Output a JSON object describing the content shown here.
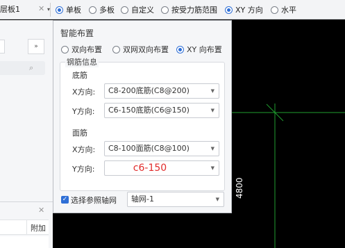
{
  "toolbar": {
    "layer_select": "层板1",
    "options": [
      {
        "label": "单板",
        "selected": true
      },
      {
        "label": "多板",
        "selected": false
      },
      {
        "label": "自定义",
        "selected": false
      },
      {
        "label": "按受力筋范围",
        "selected": false
      },
      {
        "label": "XY 方向",
        "selected": true
      },
      {
        "label": "水平",
        "selected": false
      }
    ]
  },
  "left_panel": {
    "expand_button": "»",
    "column_header": "附加"
  },
  "dialog": {
    "title": "智能布置",
    "modes": [
      {
        "label": "双向布置",
        "selected": false
      },
      {
        "label": "双网双向布置",
        "selected": false
      },
      {
        "label": "XY 向布置",
        "selected": true
      }
    ],
    "group_label": "钢筋信息",
    "bottom": {
      "title": "底筋",
      "x_label": "X方向:",
      "x_value": "C8-200底筋(C8@200)",
      "y_label": "Y方向:",
      "y_value": "C6-150底筋(C6@150)"
    },
    "top": {
      "title": "面筋",
      "x_label": "X方向:",
      "x_value": "C8-100面筋(C8@100)",
      "y_label": "Y方向:",
      "y_value": "c6-150"
    },
    "axis_checkbox_label": "选择参照轴网",
    "axis_checked": true,
    "axis_value": "轴网-1"
  },
  "canvas": {
    "dimension": "4800",
    "line_color": "#1f9e2f",
    "background": "#000000"
  },
  "colors": {
    "accent": "#2f6fd6",
    "error_text": "#e12b2b"
  }
}
